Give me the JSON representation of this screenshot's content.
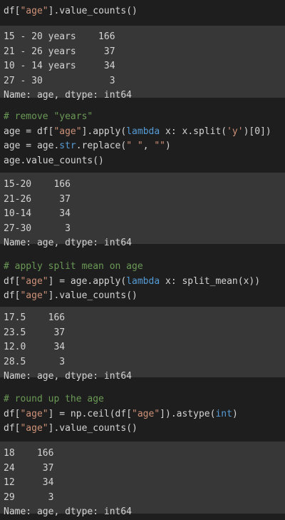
{
  "colors": {
    "code_bg": "#1e1e1e",
    "output_bg": "#373737",
    "comment": "#6a9955",
    "string": "#ce9178",
    "keyword": "#569cd6",
    "text": "#d4d4d4"
  },
  "cells": [
    {
      "type": "code",
      "lines": [
        [
          {
            "t": "df[",
            "c": "plain"
          },
          {
            "t": "\"age\"",
            "c": "string"
          },
          {
            "t": "].value_counts()",
            "c": "plain"
          }
        ]
      ]
    },
    {
      "type": "output",
      "lines": [
        "15 - 20 years    166",
        "21 - 26 years     37",
        "10 - 14 years     34",
        "27 - 30            3",
        "Name: age, dtype: int64"
      ]
    },
    {
      "type": "code",
      "lines": [
        [
          {
            "t": "# remove \"years\"",
            "c": "comment"
          }
        ],
        [
          {
            "t": "age = df[",
            "c": "plain"
          },
          {
            "t": "\"age\"",
            "c": "string"
          },
          {
            "t": "].apply(",
            "c": "plain"
          },
          {
            "t": "lambda",
            "c": "kw"
          },
          {
            "t": " x: x.split(",
            "c": "plain"
          },
          {
            "t": "'y'",
            "c": "string"
          },
          {
            "t": ")[0])",
            "c": "plain"
          }
        ],
        [
          {
            "t": "age = age.",
            "c": "plain"
          },
          {
            "t": "str",
            "c": "kw"
          },
          {
            "t": ".replace(",
            "c": "plain"
          },
          {
            "t": "\" \"",
            "c": "string"
          },
          {
            "t": ", ",
            "c": "plain"
          },
          {
            "t": "\"\"",
            "c": "string"
          },
          {
            "t": ")",
            "c": "plain"
          }
        ],
        [
          {
            "t": "age.value_counts()",
            "c": "plain"
          }
        ]
      ]
    },
    {
      "type": "output",
      "lines": [
        "15-20    166",
        "21-26     37",
        "10-14     34",
        "27-30      3",
        "Name: age, dtype: int64"
      ]
    },
    {
      "type": "code",
      "lines": [
        [
          {
            "t": "# apply split mean on age",
            "c": "comment"
          }
        ],
        [
          {
            "t": "df[",
            "c": "plain"
          },
          {
            "t": "\"age\"",
            "c": "string"
          },
          {
            "t": "] = age.apply(",
            "c": "plain"
          },
          {
            "t": "lambda",
            "c": "kw"
          },
          {
            "t": " x: split_mean(x))",
            "c": "plain"
          }
        ],
        [
          {
            "t": "df[",
            "c": "plain"
          },
          {
            "t": "\"age\"",
            "c": "string"
          },
          {
            "t": "].value_counts()",
            "c": "plain"
          }
        ]
      ]
    },
    {
      "type": "output",
      "lines": [
        "17.5    166",
        "23.5     37",
        "12.0     34",
        "28.5      3",
        "Name: age, dtype: int64"
      ]
    },
    {
      "type": "code",
      "lines": [
        [
          {
            "t": "# round up the age",
            "c": "comment"
          }
        ],
        [
          {
            "t": "df[",
            "c": "plain"
          },
          {
            "t": "\"age\"",
            "c": "string"
          },
          {
            "t": "] = np.ceil(df[",
            "c": "plain"
          },
          {
            "t": "\"age\"",
            "c": "string"
          },
          {
            "t": "]).astype(",
            "c": "plain"
          },
          {
            "t": "int",
            "c": "kw"
          },
          {
            "t": ")",
            "c": "plain"
          }
        ],
        [
          {
            "t": "df[",
            "c": "plain"
          },
          {
            "t": "\"age\"",
            "c": "string"
          },
          {
            "t": "].value_counts()",
            "c": "plain"
          }
        ]
      ]
    },
    {
      "type": "output",
      "lines": [
        "18    166",
        "24     37",
        "12     34",
        "29      3",
        "Name: age, dtype: int64"
      ]
    }
  ]
}
